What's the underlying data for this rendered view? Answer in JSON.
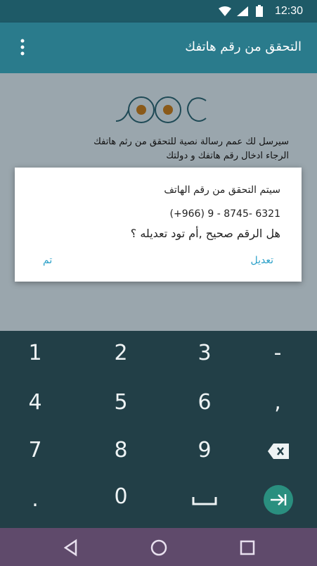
{
  "status_bar": {
    "time": "12:30"
  },
  "app_bar": {
    "title": "التحقق من رقم هاتفك",
    "menu_icon": "more-vert-icon"
  },
  "info": {
    "line1": "سيرسل لك عمم رسالة نصية للتحقق من رثم هاتفك",
    "line2": "الرجاء ادخال رقم هاتفك و دولتك"
  },
  "dialog": {
    "title": "سيتم التحقق من رقم الهاتف",
    "phone": "(+966) 9 - 8745- 6321",
    "question": "هل الرقم صحيح ,أم تود تعديله ؟",
    "edit_label": "تعديل",
    "done_label": "تم"
  },
  "keypad": {
    "rows": [
      [
        "1",
        "2",
        "3",
        "-"
      ],
      [
        "4",
        "5",
        "6",
        ","
      ],
      [
        "7",
        "8",
        "9",
        "⌫"
      ],
      [
        ".",
        "0",
        "␣",
        "⇥"
      ]
    ]
  },
  "colors": {
    "status_bar": "#1e5a67",
    "app_bar": "#2a7b8c",
    "background": "#9aa6ad",
    "keypad": "#223f47",
    "nav_bar": "#5f4a6b",
    "accent": "#2aa0c8",
    "logo_dot": "#8a5a1a"
  }
}
